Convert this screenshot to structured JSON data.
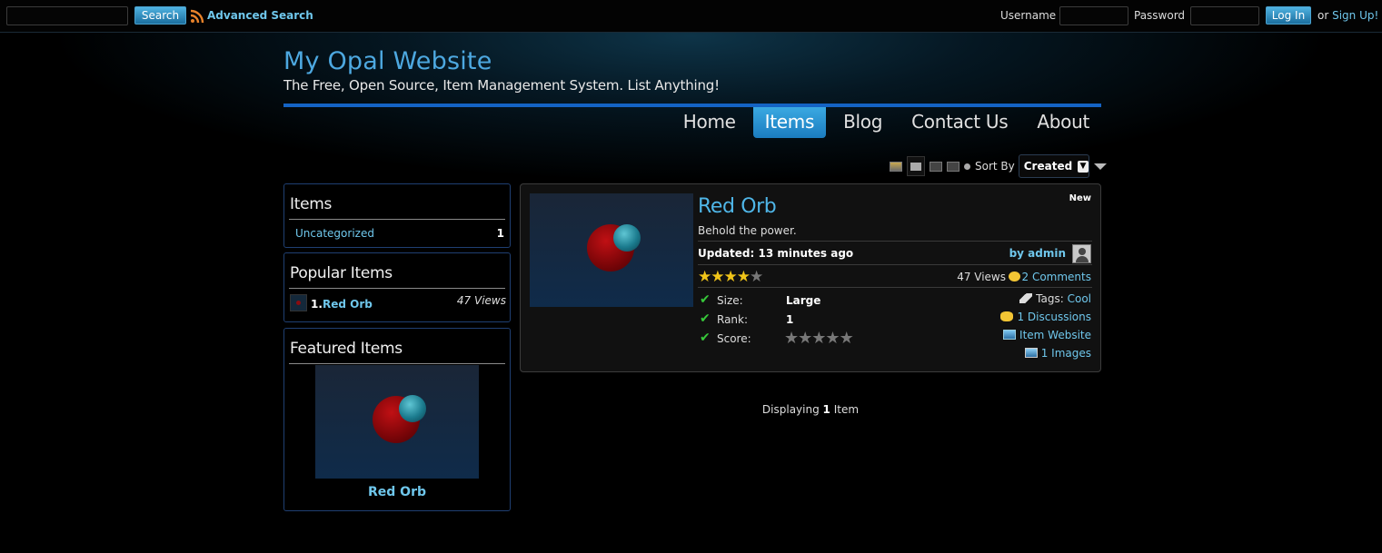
{
  "topbar": {
    "search_button": "Search",
    "advanced_search": "Advanced Search",
    "username_label": "Username",
    "password_label": "Password",
    "login_button": "Log In",
    "or_text": "or",
    "signup_link": "Sign Up!"
  },
  "header": {
    "site_title": "My Opal Website",
    "tagline": "The Free, Open Source, Item Management System. List Anything!"
  },
  "nav": [
    {
      "label": "Home"
    },
    {
      "label": "Items"
    },
    {
      "label": "Blog"
    },
    {
      "label": "Contact Us"
    },
    {
      "label": "About"
    }
  ],
  "nav_active": "Items",
  "viewbar": {
    "sort_label": "Sort By",
    "sort_value": "Created"
  },
  "sidebar": {
    "items_box": {
      "title": "Items",
      "category_name": "Uncategorized",
      "category_count": "1"
    },
    "popular_box": {
      "title": "Popular Items",
      "rank": "1.",
      "item_name": "Red Orb",
      "views": "47 Views"
    },
    "featured_box": {
      "title": "Featured Items",
      "item_name": "Red Orb"
    }
  },
  "item": {
    "badge": "New",
    "title": "Red Orb",
    "description": "Behold the power.",
    "updated": "Updated: 13 minutes ago",
    "by": "by admin",
    "rating": 4,
    "rating_max": 5,
    "views": "47 Views",
    "comments": "2 Comments",
    "attributes": [
      {
        "label": "Size:",
        "value": "Large"
      },
      {
        "label": "Rank:",
        "value": "1"
      },
      {
        "label": "Score:",
        "value": ""
      }
    ],
    "score_rating": 0,
    "tags_label": "Tags:",
    "tag": "Cool",
    "discussions": "1 Discussions",
    "website": "Item Website",
    "images": "1 Images"
  },
  "footer": {
    "displaying_prefix": "Displaying",
    "displaying_count": "1",
    "displaying_suffix": "Item"
  },
  "colors": {
    "accent": "#4da8e0",
    "link": "#6fc7ec",
    "nav_active": "#2a93d4",
    "header_rule": "#1463c4"
  }
}
